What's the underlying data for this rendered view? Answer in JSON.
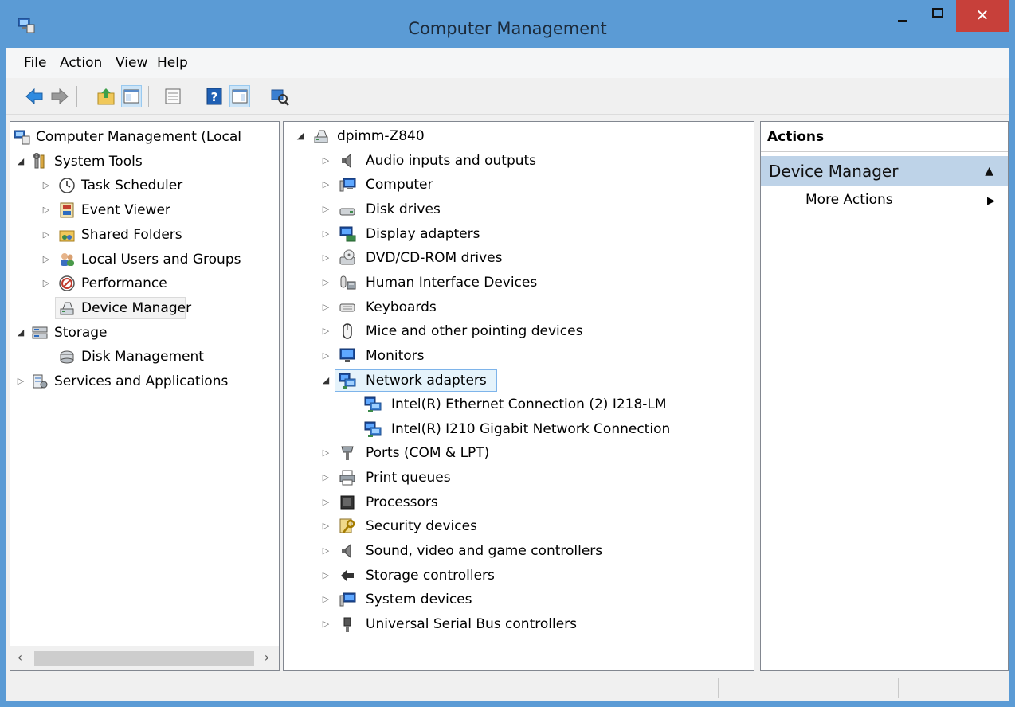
{
  "window": {
    "title": "Computer Management",
    "close_glyph": "✕",
    "accent_color": "#5b9bd5",
    "close_color": "#c7403a"
  },
  "menubar": [
    "File",
    "Action",
    "View",
    "Help"
  ],
  "toolbar": {
    "buttons": [
      "back-arrow-icon",
      "forward-arrow-icon",
      "up-folder-icon",
      "show-hide-tree-icon",
      "properties-icon",
      "help-icon",
      "show-hide-action-pane-icon",
      "scan-hardware-icon"
    ]
  },
  "left_tree": [
    {
      "label": "Computer Management (Local",
      "icon": "computer-management-icon",
      "level": 0,
      "expander": ""
    },
    {
      "label": "System Tools",
      "icon": "tools-icon",
      "level": 1,
      "expander": "◢"
    },
    {
      "label": "Task Scheduler",
      "icon": "clock-icon",
      "level": 2,
      "expander": "▷"
    },
    {
      "label": "Event Viewer",
      "icon": "event-viewer-icon",
      "level": 2,
      "expander": "▷"
    },
    {
      "label": "Shared Folders",
      "icon": "shared-folder-icon",
      "level": 2,
      "expander": "▷"
    },
    {
      "label": "Local Users and Groups",
      "icon": "users-icon",
      "level": 2,
      "expander": "▷"
    },
    {
      "label": "Performance",
      "icon": "performance-icon",
      "level": 2,
      "expander": "▷"
    },
    {
      "label": "Device Manager",
      "icon": "device-manager-icon",
      "level": 2,
      "expander": "",
      "selected": true
    },
    {
      "label": "Storage",
      "icon": "storage-icon",
      "level": 1,
      "expander": "◢"
    },
    {
      "label": "Disk Management",
      "icon": "disk-management-icon",
      "level": 2,
      "expander": ""
    },
    {
      "label": "Services and Applications",
      "icon": "services-icon",
      "level": 1,
      "expander": "▷"
    }
  ],
  "device_tree": {
    "root": "dpimm-Z840",
    "categories": [
      {
        "label": "Audio inputs and outputs",
        "icon": "speaker-icon"
      },
      {
        "label": "Computer",
        "icon": "computer-icon"
      },
      {
        "label": "Disk drives",
        "icon": "disk-drive-icon"
      },
      {
        "label": "Display adapters",
        "icon": "display-adapter-icon"
      },
      {
        "label": "DVD/CD-ROM drives",
        "icon": "dvd-drive-icon"
      },
      {
        "label": "Human Interface Devices",
        "icon": "hid-icon"
      },
      {
        "label": "Keyboards",
        "icon": "keyboard-icon"
      },
      {
        "label": "Mice and other pointing devices",
        "icon": "mouse-icon"
      },
      {
        "label": "Monitors",
        "icon": "monitor-icon"
      },
      {
        "label": "Network adapters",
        "icon": "network-adapter-icon",
        "expanded": true,
        "children": [
          "Intel(R) Ethernet Connection (2) I218-LM",
          "Intel(R) I210 Gigabit Network Connection"
        ]
      },
      {
        "label": "Ports (COM & LPT)",
        "icon": "port-icon"
      },
      {
        "label": "Print queues",
        "icon": "printer-icon"
      },
      {
        "label": "Processors",
        "icon": "processor-icon"
      },
      {
        "label": "Security devices",
        "icon": "security-key-icon"
      },
      {
        "label": "Sound, video and game controllers",
        "icon": "speaker-icon"
      },
      {
        "label": "Storage controllers",
        "icon": "storage-controller-icon"
      },
      {
        "label": "System devices",
        "icon": "system-device-icon"
      },
      {
        "label": "Universal Serial Bus controllers",
        "icon": "usb-icon"
      }
    ]
  },
  "actions": {
    "header": "Actions",
    "section": "Device Manager",
    "items": [
      "More Actions"
    ]
  }
}
